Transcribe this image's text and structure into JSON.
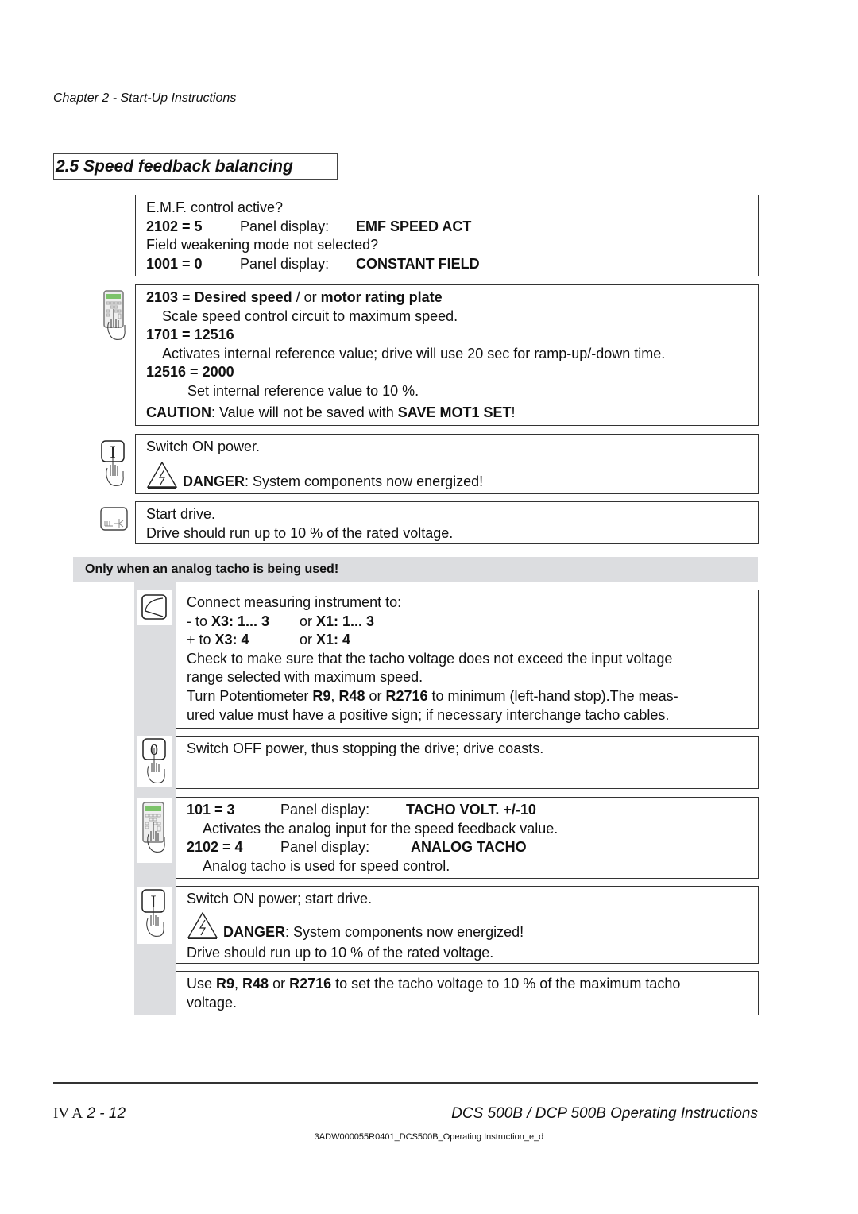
{
  "header": {
    "chapter": "Chapter 2 - Start-Up Instructions",
    "section_title": "2.5 Speed feedback balancing"
  },
  "steps": {
    "emf": {
      "q1": "E.M.F. control active?",
      "p1_code": "2102 = 5",
      "p1_label": "Panel display:",
      "p1_value": "EMF SPEED ACT",
      "q2": "Field weakening mode not selected?",
      "p2_code": "1001 = 0",
      "p2_label": "Panel display:",
      "p2_value": "CONSTANT FIELD"
    },
    "scale": {
      "l1_code": "2103",
      "l1_eq": " = ",
      "l1_b1": "Desired speed",
      "l1_mid": " / or ",
      "l1_b2": "motor rating plate",
      "l2": "Scale speed control circuit to maximum speed.",
      "l3": "1701 = 12516",
      "l4": "Activates internal reference value; drive will use 20 sec for ramp-up/-down time.",
      "l5": "12516 = 2000",
      "l6": "Set internal reference value to 10 %.",
      "caution_label": "CAUTION",
      "caution_text": ": Value will not be saved with ",
      "caution_bold": "SAVE MOT1 SET",
      "caution_end": "!"
    },
    "switch_on": {
      "l1": "Switch ON power.",
      "danger_label": "DANGER",
      "danger_text": ": System components now energized!"
    },
    "start": {
      "l1": "Start drive.",
      "l2": "Drive should run up to 10 % of the rated voltage."
    }
  },
  "tacho_banner": "Only when an analog tacho is being used!",
  "tacho": {
    "connect": {
      "l1": "Connect measuring instrument to:",
      "r1_pre": "- to ",
      "r1_b": "X3: 1... 3",
      "r1_or": "or ",
      "r1_b2": "X1: 1... 3",
      "r2_pre": "+ to ",
      "r2_b": "X3: 4",
      "r2_or": "or ",
      "r2_b2": "X1: 4",
      "l4": "Check to make sure that the tacho voltage does not exceed the input voltage",
      "l5": "range selected with maximum speed.",
      "l6_pre": "Turn Potentiometer ",
      "l6_b1": "R9",
      "l6_c": ", ",
      "l6_b2": "R48",
      "l6_or": " or ",
      "l6_b3": "R2716",
      "l6_post": " to minimum (left-hand stop).The meas-",
      "l7": "ured value must have a positive sign; if necessary interchange tacho cables."
    },
    "switch_off": {
      "l1": "Switch OFF power, thus stopping the drive; drive coasts."
    },
    "params": {
      "p1_code": "101 = 3",
      "p1_label": "Panel display:",
      "p1_value": "TACHO VOLT. +/-10",
      "p1_desc": "Activates the analog input for the speed feedback value.",
      "p2_code": "2102 = 4",
      "p2_label": "Panel display:",
      "p2_value": "ANALOG TACHO",
      "p2_desc": "Analog tacho is used for speed control."
    },
    "switch_on": {
      "l1": "Switch ON power; start drive.",
      "danger_label": "DANGER",
      "danger_text": ": System components now energized!",
      "l3": "Drive should run up to 10 % of the rated voltage."
    },
    "adjust": {
      "pre": "Use ",
      "b1": "R9",
      "c": ", ",
      "b2": "R48",
      "or": " or ",
      "b3": "R2716",
      "post": " to set the tacho voltage to 10 % of the maximum tacho",
      "l2": "voltage."
    }
  },
  "footer": {
    "roman": "IV A",
    "page": "2 - 12",
    "title": "DCS 500B / DCP 500B Operating Instructions",
    "doc_id": "3ADW000055R0401_DCS500B_Operating Instruction_e_d"
  }
}
